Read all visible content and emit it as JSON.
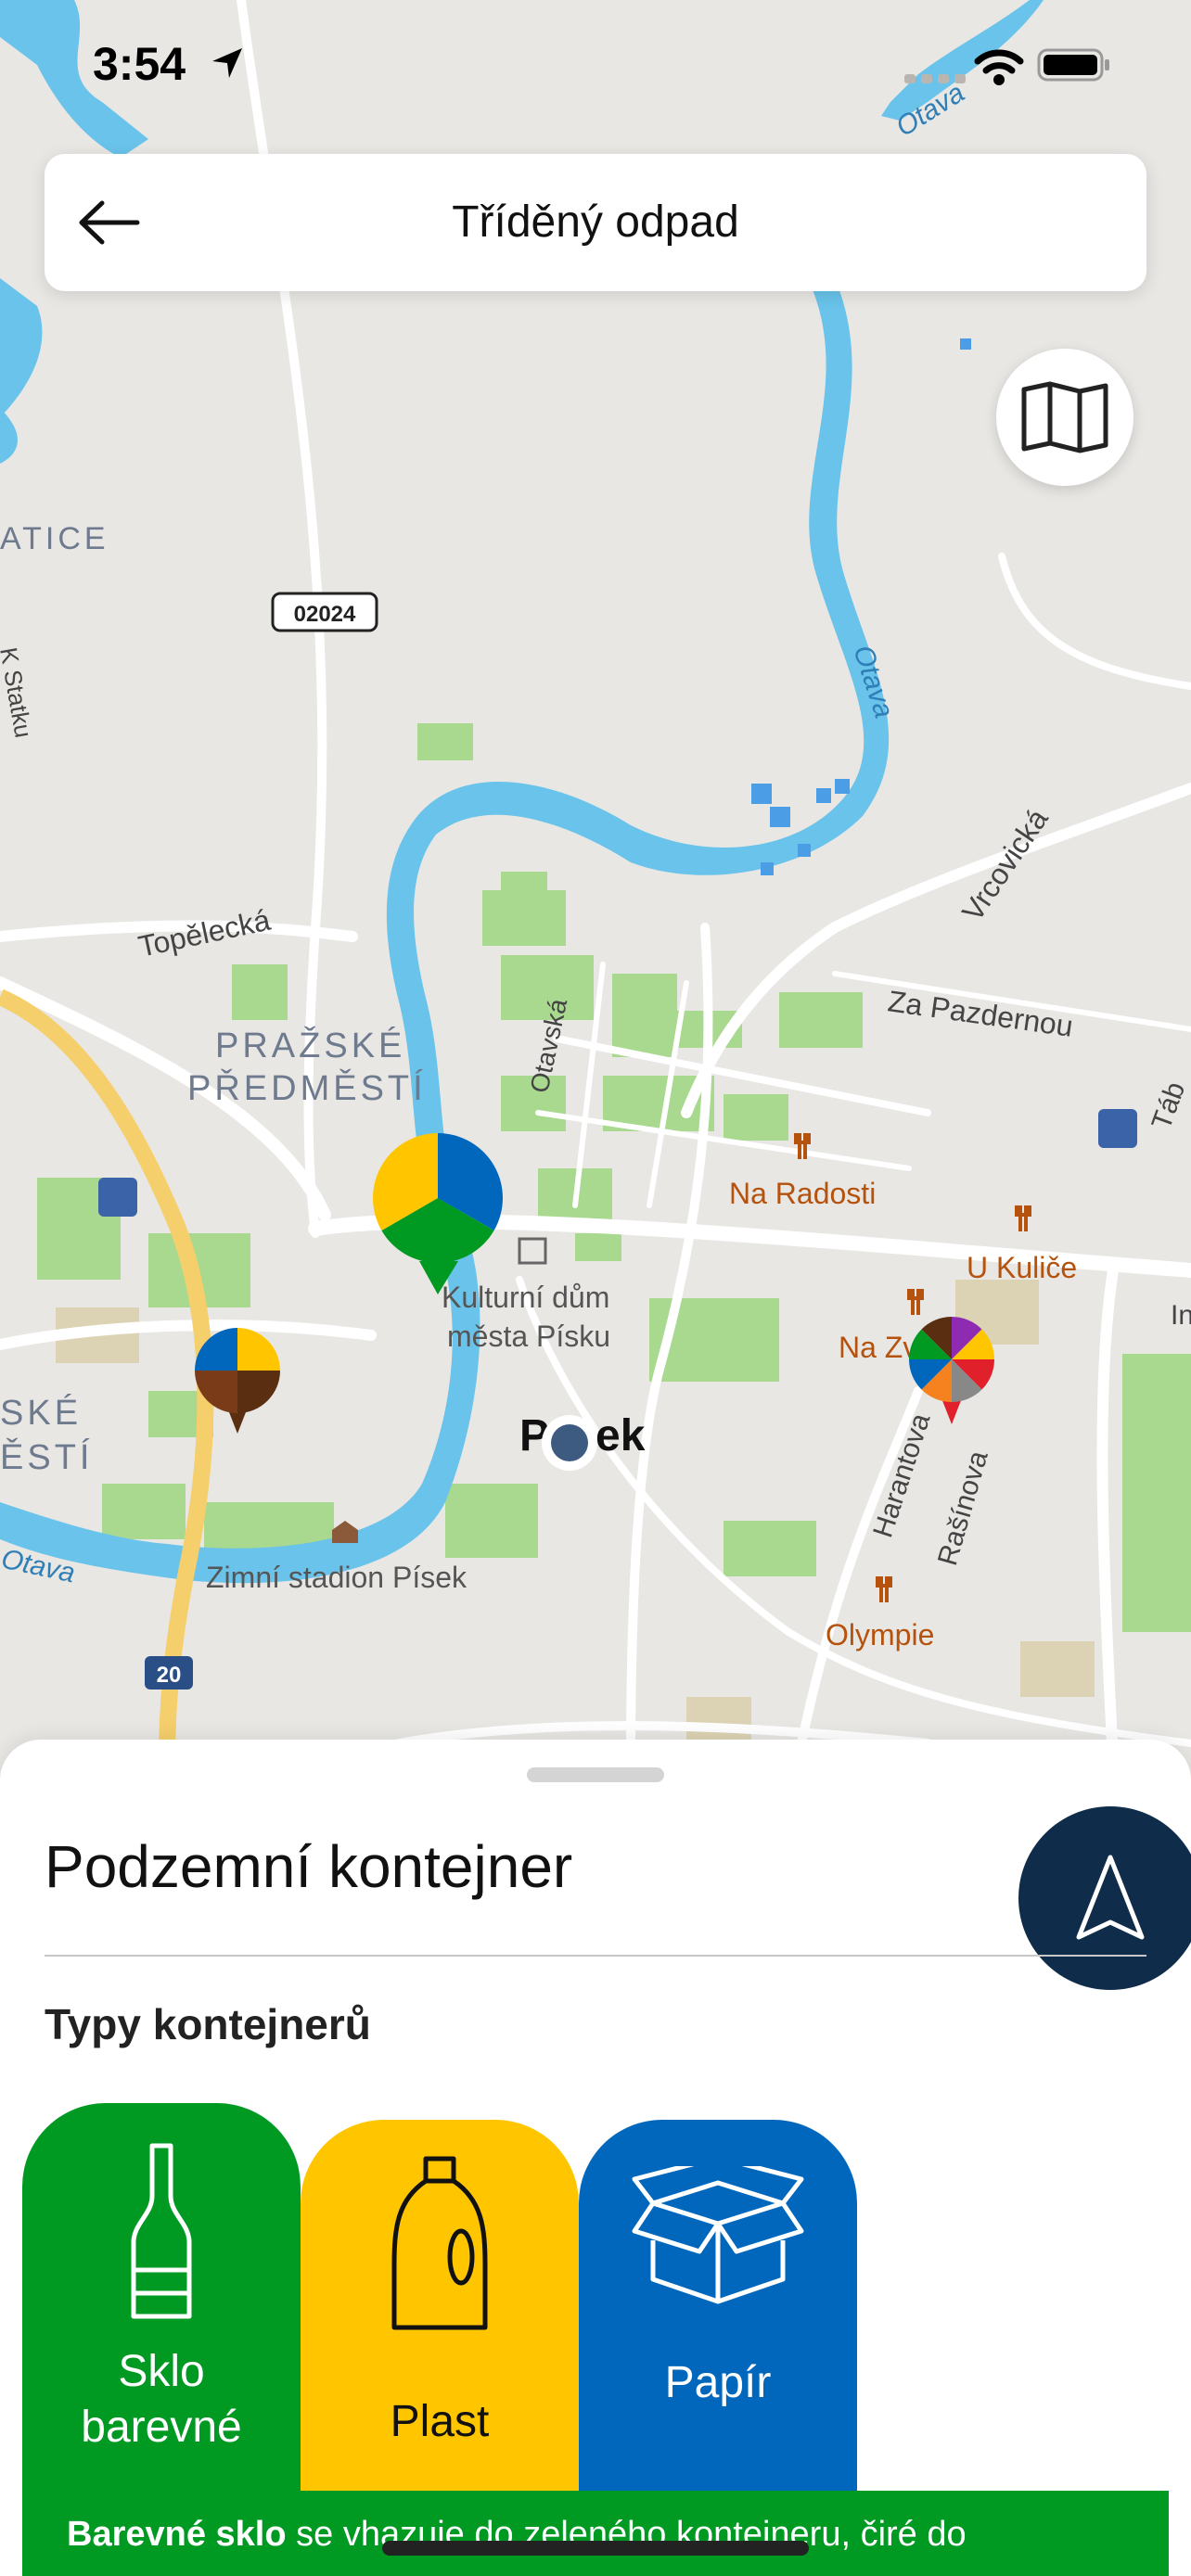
{
  "status": {
    "time": "3:54"
  },
  "header": {
    "title": "Tříděný odpad"
  },
  "map": {
    "labels": {
      "district_atice": "ATICE",
      "road_02024": "02024",
      "road_20": "20",
      "street_kestatku": "K Statku",
      "street_topelecka": "Topělecká",
      "district_prazske": "PRAŽSKÉ",
      "district_predmesti": "PŘEDMĚSTÍ",
      "street_otavska": "Otavská",
      "river_otava_1": "Otava",
      "river_otava_2": "Otava",
      "river_otava_3": "Otava",
      "street_vrcovicka": "Vrcovická",
      "street_zapazdernou": "Za Pazdernou",
      "poi_naradosti": "Na Radosti",
      "poi_ukulice": "U Kuliče",
      "poi_nazvo": "Na Zvo",
      "poi_kulturni_1": "Kulturní dům",
      "poi_kulturni_2": "města Písku",
      "town_pisek_1": "P",
      "town_pisek_2": "ek",
      "street_harantova": "Harantova",
      "street_rasinova": "Rašínova",
      "poi_olympie": "Olympie",
      "poi_zimni": "Zimní stadion Písek",
      "district_ske": "SKÉ",
      "district_esti": "ĚSTÍ",
      "street_tab": "Táb",
      "street_in": "In"
    },
    "colors": {
      "land": "#e9e7e4",
      "water": "#69c3ea",
      "park": "#a9d98f",
      "road": "#ffffff",
      "highway": "#f5cf6c",
      "poi": "#b5520d",
      "district": "#6e7a8e"
    }
  },
  "sheet": {
    "title": "Podzemní kontejner",
    "section_label": "Typy kontejnerů",
    "types": [
      {
        "label_line1": "Sklo",
        "label_line2": "barevné",
        "color": "#009a22",
        "icon": "bottle-icon"
      },
      {
        "label": "Plast",
        "color": "#ffc600",
        "icon": "plastic-bottle-icon"
      },
      {
        "label": "Papír",
        "color": "#0067bd",
        "icon": "box-icon"
      }
    ],
    "description_bold": "Barevné sklo",
    "description_rest": " se vhazuje do zeleného kontejneru, čiré do"
  }
}
